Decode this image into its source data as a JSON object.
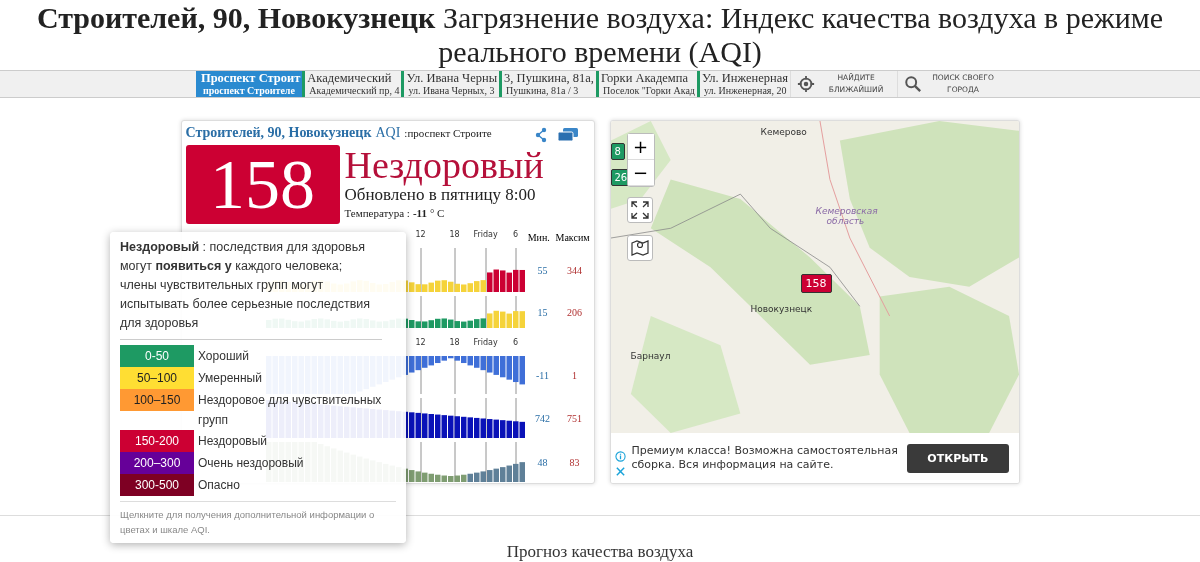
{
  "title": {
    "text": "**Строителей, 90, Новокузнецк** Загрязнение воздуха: Индекс качества воздуха в режиме реального времени (AQI)"
  },
  "stations": [
    {
      "name": "Проспект Строит",
      "address": "проспект Строителе",
      "selected": true
    },
    {
      "name": "Академический",
      "address": "Академический пр, 4",
      "selected": false,
      "color": "#1e9a63"
    },
    {
      "name": "Ул. Ивана Черны",
      "address": "ул. Ивана Черных, 3",
      "selected": false,
      "color": "#1e9a63"
    },
    {
      "name": "3, Пушкина, 81а,",
      "address": "Пушкина, 81а / 3",
      "selected": false,
      "color": "#1e9a63"
    },
    {
      "name": "Горки Академпа",
      "address": "Поселок \"Горки Акад",
      "selected": false,
      "color": "#1e9a63"
    },
    {
      "name": "Ул. Инженерная",
      "address": "ул. Инженерная, 20",
      "selected": false,
      "color": "#1e9a63"
    }
  ],
  "nav_buttons": [
    {
      "kind": "nearest",
      "label": "НАЙДИТЕ БЛИЖАЙШИЙ"
    },
    {
      "kind": "search",
      "label": "ПОИСК СВОЕГО ГОРОДА"
    }
  ],
  "card": {
    "city": "Строителей, 90, Новокузнецк",
    "aqi_label": "AQI",
    "station": ":проспект Строите",
    "aqi": "158",
    "level": "Нездоровый",
    "updated": "Обновлено в пятницу 8:00",
    "temperature_label": "Температура :",
    "temperature": "-11",
    "temperature_unit": "° C"
  },
  "charts": {
    "columns": [
      "Мин.",
      "Максим"
    ],
    "axis_pollution": [
      "12",
      "18",
      "Friday",
      "6"
    ],
    "axis_weather": [
      "12",
      "18",
      "Friday",
      "6"
    ],
    "rows": [
      {
        "kind": "pm25",
        "min": "55",
        "max": "344"
      },
      {
        "kind": "pm10",
        "min": "15",
        "max": "206"
      },
      {
        "kind": "temperature",
        "min": "-11",
        "max": "1"
      },
      {
        "kind": "pressure",
        "min": "742",
        "max": "751"
      },
      {
        "kind": "humidity",
        "min": "48",
        "max": "83"
      }
    ]
  },
  "tooltip": {
    "text": "**Нездоровый** : последствия для здоровья могут **появиться у** каждого человека; члены чувствительных групп могут испытывать более серьезные последствия для здоровья",
    "scale": [
      {
        "range": "0-50",
        "label": "Хороший",
        "color": "#1e9a63"
      },
      {
        "range": "50–100",
        "label": "Умеренный",
        "color": "#ffde33"
      },
      {
        "range": "100–150",
        "label": "Нездоровое для чувствительных групп",
        "color": "#ff9933"
      },
      {
        "range": "150-200",
        "label": "Нездоровый",
        "color": "#cc0033"
      },
      {
        "range": "200–300",
        "label": "Очень нездоровый",
        "color": "#660099"
      },
      {
        "range": "300-500",
        "label": "Опасно",
        "color": "#7e0023"
      }
    ],
    "footer": "Щелкните для получения дополнительной информации о цветах и шкале AQI."
  },
  "map": {
    "zoom_in": "+",
    "zoom_out": "−",
    "labels": [
      {
        "kind": "city",
        "text": "Кемерово"
      },
      {
        "kind": "region",
        "text": "Кемеровская область"
      },
      {
        "kind": "city",
        "text": "Новокузнецк"
      },
      {
        "kind": "city",
        "text": "Барнаул"
      }
    ],
    "markers": [
      {
        "value": "158",
        "color": "#cc0033"
      },
      {
        "value": "8",
        "color": "#1e9a63"
      },
      {
        "value": "26",
        "color": "#1e9a63"
      }
    ]
  },
  "ad": {
    "text": "Премиум класса! Возможна самостоятельная сборка. Вся информация на сайте.",
    "button": "ОТКРЫТЬ"
  },
  "forecast": {
    "heading": "Прогноз качества воздуха"
  }
}
